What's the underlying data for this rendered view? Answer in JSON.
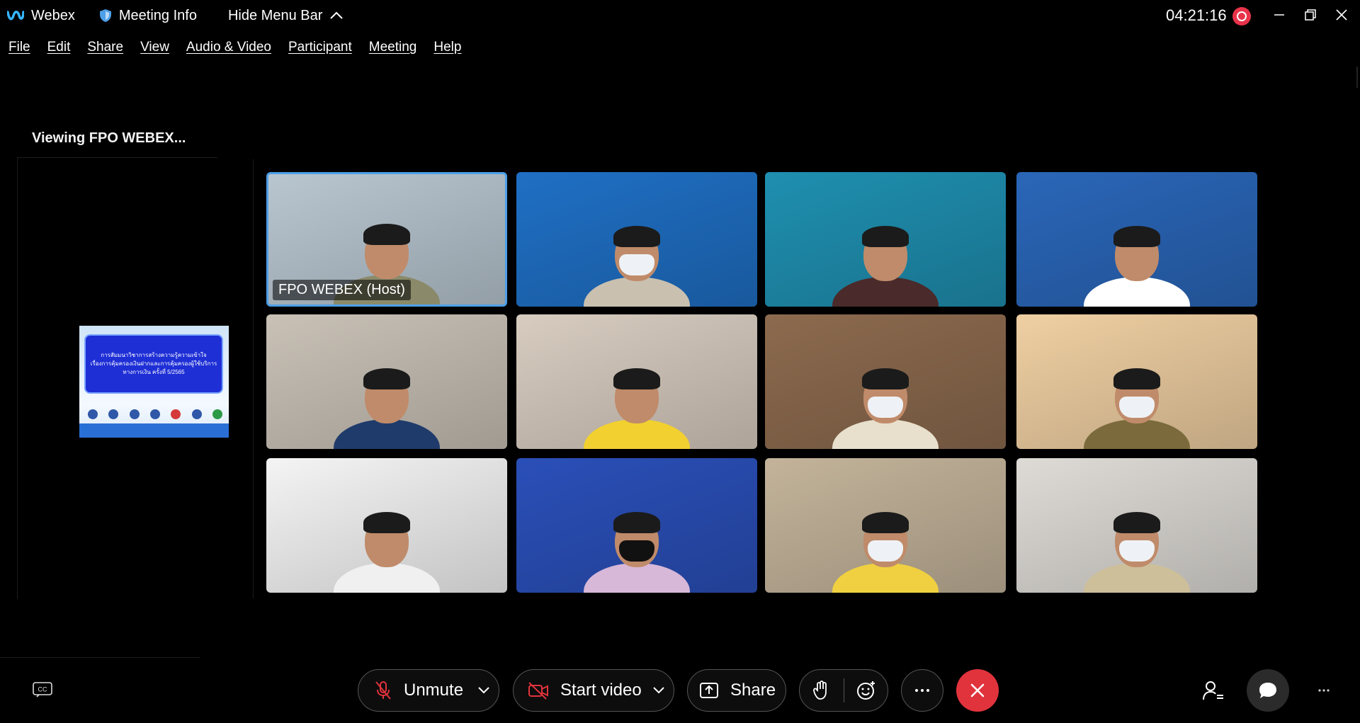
{
  "titlebar": {
    "app_name": "Webex",
    "meeting_info": "Meeting Info",
    "hide_menu": "Hide Menu Bar",
    "timer": "04:21:16"
  },
  "menu": [
    "File",
    "Edit",
    "Share",
    "View",
    "Audio & Video",
    "Participant",
    "Meeting",
    "Help"
  ],
  "sidebar": {
    "viewing_label": "Viewing FPO WEBEX...",
    "slide_lines": [
      "การสัมมนาวิชาการสร้างความรู้ความเข้าใจ",
      "เรื่องการคุ้มครองเงินฝากและการคุ้มครองผู้ใช้บริการ",
      "ทางการเงิน ครั้งที่ 5/2565"
    ]
  },
  "grid": {
    "host_name": "FPO WEBEX (Host)",
    "tiles": [
      {
        "bg": "#b8c6d0",
        "shirt": "#8a8a6a",
        "mask": false
      },
      {
        "bg": "#1f6fc4",
        "shirt": "#c9c0b0",
        "mask": true
      },
      {
        "bg": "#1f8fb0",
        "shirt": "#4a2a2a",
        "mask": false
      },
      {
        "bg": "#2a66b8",
        "shirt": "#ffffff",
        "mask": false
      },
      {
        "bg": "#c9c1b6",
        "shirt": "#1f3b6b",
        "mask": false
      },
      {
        "bg": "#d8ccc0",
        "shirt": "#f2d030",
        "mask": false
      },
      {
        "bg": "#8c6a4e",
        "shirt": "#e8e0cc",
        "mask": true
      },
      {
        "bg": "#efcfa2",
        "shirt": "#7b6a3c",
        "mask": true
      },
      {
        "bg": "#f4f4f4",
        "shirt": "#f0f0f0",
        "mask": false
      },
      {
        "bg": "#2a4fb8",
        "shirt": "#d8b8d8",
        "mask": true,
        "mask_dark": true
      },
      {
        "bg": "#c3b39a",
        "shirt": "#f0d040",
        "mask": true
      },
      {
        "bg": "#dedbd6",
        "shirt": "#cdbf9a",
        "mask": true
      }
    ]
  },
  "toolbar": {
    "unmute": "Unmute",
    "start_video": "Start video",
    "share": "Share"
  },
  "icons": {
    "cc": "closed-captions-icon",
    "mic": "microphone-muted-icon",
    "video": "video-off-icon",
    "share": "share-screen-icon",
    "hand": "raise-hand-icon",
    "reaction": "reaction-icon",
    "more": "more-icon",
    "end": "end-call-icon",
    "participants": "participants-icon",
    "chat": "chat-icon"
  },
  "colors": {
    "accent": "#4d9fe8",
    "end_call": "#e1333c",
    "recording": "#e8334a"
  }
}
